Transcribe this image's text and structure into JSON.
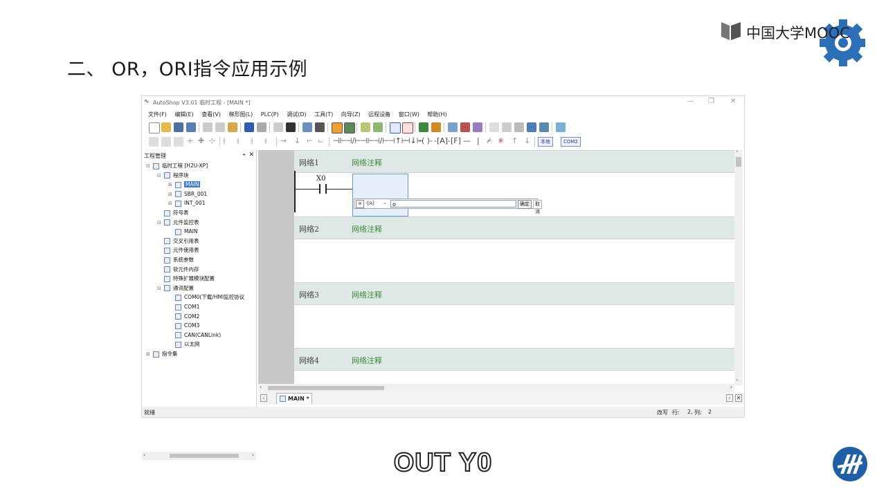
{
  "slide": {
    "title": "二、 OR，ORI指令应用示例",
    "mooc_brand": "中国大学MOOC",
    "subtitle": "OUT Y0"
  },
  "window": {
    "title": "AutoShop V3.01  临时工程 - [MAIN *]",
    "controls": [
      "—",
      "❐",
      "✕"
    ]
  },
  "menu": [
    "文件(F)",
    "编辑(E)",
    "查看(V)",
    "梯形图(L)",
    "PLC(P)",
    "调试(D)",
    "工具(T)",
    "向导(Z)",
    "远程设备",
    "窗口(W)",
    "帮助(H)"
  ],
  "toolbar2": {
    "local_button": "本地",
    "com_button": "COM2"
  },
  "project_pane": {
    "title": "工程管理",
    "pin": "⌖",
    "close": "✕",
    "items": [
      {
        "label": "临时工程 [H2U-XP]",
        "level": 0,
        "expander": "⊟"
      },
      {
        "label": "程序块",
        "level": 1,
        "expander": "⊟"
      },
      {
        "label": "MAIN",
        "level": 2,
        "expander": "⊞",
        "selected": true
      },
      {
        "label": "SBR_001",
        "level": 2,
        "expander": "⊞"
      },
      {
        "label": "INT_001",
        "level": 2,
        "expander": "⊞"
      },
      {
        "label": "符号表",
        "level": 1,
        "expander": ""
      },
      {
        "label": "元件监控表",
        "level": 1,
        "expander": "⊟"
      },
      {
        "label": "MAIN",
        "level": 2,
        "expander": ""
      },
      {
        "label": "交叉引用表",
        "level": 1,
        "expander": ""
      },
      {
        "label": "元件使用表",
        "level": 1,
        "expander": ""
      },
      {
        "label": "系统参数",
        "level": 1,
        "expander": ""
      },
      {
        "label": "软元件内存",
        "level": 1,
        "expander": ""
      },
      {
        "label": "特殊扩展模块配置",
        "level": 1,
        "expander": ""
      },
      {
        "label": "通讯配置",
        "level": 1,
        "expander": "⊟"
      },
      {
        "label": "COM0(下载/HMI监控协议",
        "level": 2,
        "expander": ""
      },
      {
        "label": "COM1",
        "level": 2,
        "expander": ""
      },
      {
        "label": "COM2",
        "level": 2,
        "expander": ""
      },
      {
        "label": "COM3",
        "level": 2,
        "expander": ""
      },
      {
        "label": "CAN(CANLink)",
        "level": 2,
        "expander": ""
      },
      {
        "label": "以太网",
        "level": 2,
        "expander": ""
      },
      {
        "label": "指令集",
        "level": 0,
        "expander": "⊞"
      }
    ]
  },
  "networks": [
    {
      "label": "网络1",
      "comment": "网络注释"
    },
    {
      "label": "网络2",
      "comment": "网络注释"
    },
    {
      "label": "网络3",
      "comment": "网络注释"
    },
    {
      "label": "网络4",
      "comment": "网络注释"
    }
  ],
  "ladder": {
    "contact_label": "X0"
  },
  "input_popup": {
    "mode": "-[A]",
    "value": "o",
    "ok": "确定",
    "cancel": "取消"
  },
  "tabs": [
    {
      "label": "MAIN *",
      "active": true
    }
  ],
  "status": {
    "ready": "就绪",
    "mode": "改写",
    "row_label": "行:",
    "row": "2,",
    "col_label": "列:",
    "col": "2"
  },
  "colors": {
    "network_header_bg": "#dfe8e6",
    "comment_green": "#3a8a3a",
    "selection_blue": "#3b78d8",
    "gear_blue": "#2a6fb8"
  }
}
